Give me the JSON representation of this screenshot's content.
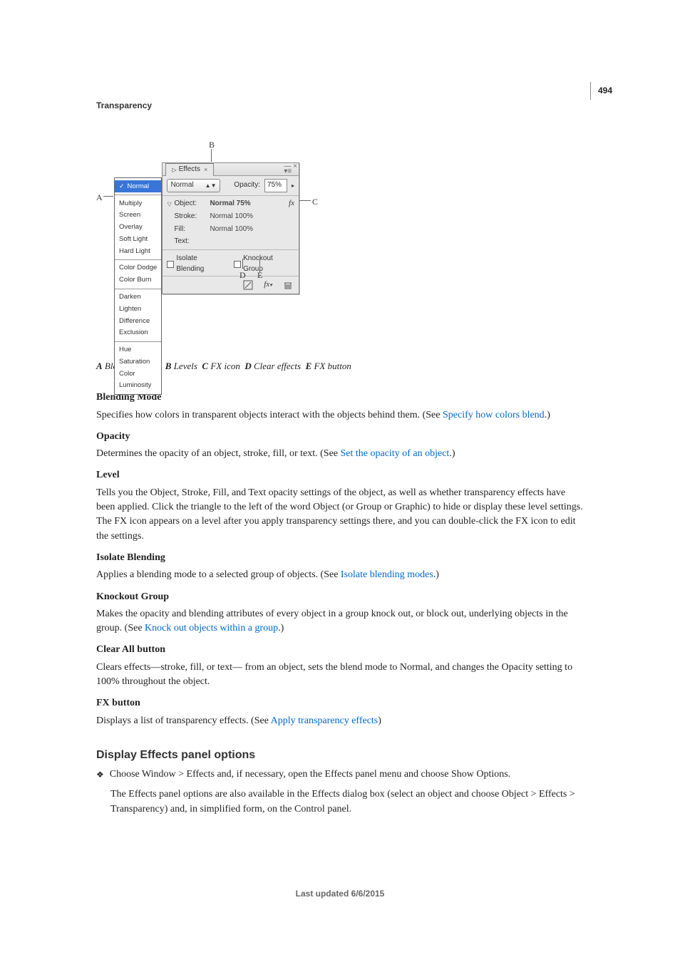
{
  "page_number": "494",
  "section": "Transparency",
  "figure": {
    "callouts": {
      "A": "A",
      "B": "B",
      "C": "C",
      "D": "D",
      "E": "E"
    },
    "panel": {
      "tab_label": "Effects",
      "blend_dropdown_value": "Normal",
      "opacity_label": "Opacity:",
      "opacity_value": "75%",
      "levels": [
        {
          "tri": "▽",
          "name": "Object:",
          "value": "Normal 75%",
          "fx": true
        },
        {
          "tri": "",
          "name": "Stroke:",
          "value": "Normal 100%",
          "fx": false
        },
        {
          "tri": "",
          "name": "Fill:",
          "value": "Normal 100%",
          "fx": false
        },
        {
          "tri": "",
          "name": "Text:",
          "value": "",
          "fx": false
        }
      ],
      "isolate_label": "Isolate Blending",
      "knockout_label": "Knockout Group"
    },
    "blend_modes": [
      [
        "Normal"
      ],
      [
        "Multiply",
        "Screen",
        "Overlay",
        "Soft Light",
        "Hard Light"
      ],
      [
        "Color Dodge",
        "Color Burn"
      ],
      [
        "Darken",
        "Lighten",
        "Difference",
        "Exclusion"
      ],
      [
        "Hue",
        "Saturation",
        "Color",
        "Luminosity"
      ]
    ],
    "caption": {
      "A": "Blending mode",
      "B": "Levels",
      "C": "FX icon",
      "D": "Clear effects",
      "E": "FX button"
    }
  },
  "definitions": [
    {
      "term": "Blending Mode",
      "text_before": "Specifies how colors in transparent objects interact with the objects behind them. (See ",
      "link": "Specify how colors blend",
      "text_after": ".)"
    },
    {
      "term": "Opacity",
      "text_before": "Determines the opacity of an object, stroke, fill, or text. (See ",
      "link": "Set the opacity of an object",
      "text_after": ".)"
    },
    {
      "term": "Level",
      "full": "Tells you the Object, Stroke, Fill, and Text opacity settings of the object, as well as whether transparency effects have been applied. Click the triangle to the left of the word Object (or Group or Graphic) to hide or display these level settings. The FX icon appears on a level after you apply transparency settings there, and you can double-click the FX icon to edit the settings."
    },
    {
      "term": "Isolate Blending",
      "text_before": "Applies a blending mode to a selected group of objects. (See ",
      "link": "Isolate blending modes",
      "text_after": ".)"
    },
    {
      "term": "Knockout Group",
      "text_before": "Makes the opacity and blending attributes of every object in a group knock out, or block out, underlying objects in the group. (See ",
      "link": "Knock out objects within a group",
      "text_after": ".)"
    },
    {
      "term": "Clear All button",
      "full": "Clears effects—stroke, fill, or text— from an object, sets the blend mode to Normal, and changes the Opacity setting to 100% throughout the object."
    },
    {
      "term": "FX button",
      "text_before": "Displays a list of transparency effects. (See ",
      "link": "Apply transparency effects",
      "text_after": ")"
    }
  ],
  "subsection": {
    "heading": "Display Effects panel options",
    "bullet": "Choose Window > Effects and, if necessary, open the Effects panel menu and choose Show Options.",
    "follow": "The Effects panel options are also available in the Effects dialog box (select an object and choose Object > Effects > Transparency) and, in simplified form, on the Control panel."
  },
  "footer": "Last updated 6/6/2015"
}
